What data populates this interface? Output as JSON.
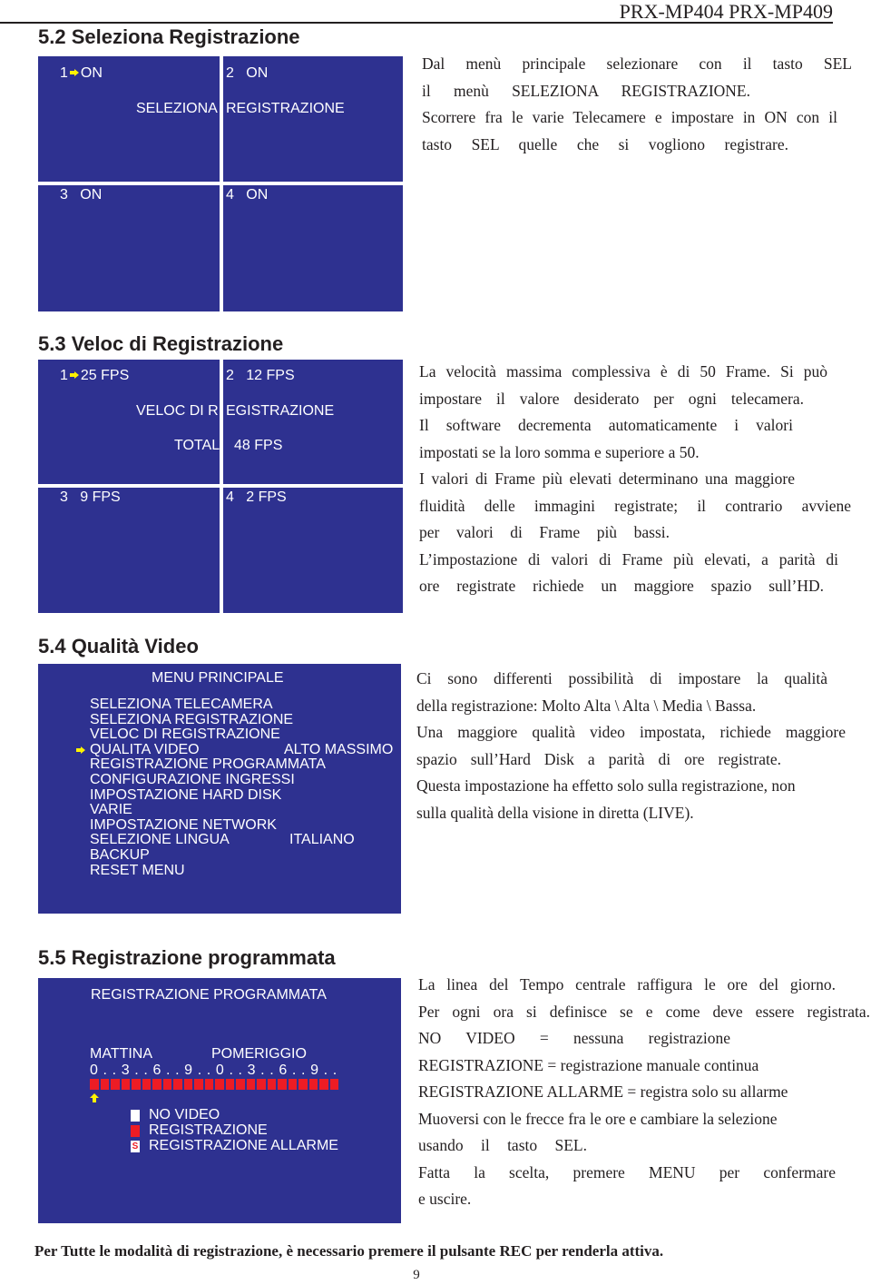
{
  "header": {
    "model": "PRX-MP404  PRX-MP409"
  },
  "colors": {
    "osd_background": "#2e3190",
    "osd_text": "#ffffff",
    "cursor_arrow": "#fff200",
    "recording_block": "#ed1c24"
  },
  "section_5_2": {
    "title": "5.2 Seleziona Registrazione",
    "screen": {
      "title_left": "SELEZIONA",
      "title_right": "REGISTRAZIONE",
      "cameras": [
        {
          "num": "1",
          "value": "ON",
          "selected": true
        },
        {
          "num": "2",
          "value": "ON",
          "selected": false
        },
        {
          "num": "3",
          "value": "ON",
          "selected": false
        },
        {
          "num": "4",
          "value": "ON",
          "selected": false
        }
      ]
    },
    "description": [
      "Dal menù principale selezionare con il tasto SEL",
      "il menù SELEZIONA REGISTRAZIONE.",
      "Scorrere fra le varie Telecamere e impostare in ON con il",
      "tasto SEL quelle che si vogliono registrare."
    ]
  },
  "section_5_3": {
    "title": "5.3 Veloc di Registrazione",
    "screen": {
      "title_left": "VELOC DI R",
      "title_right": "EGISTRAZIONE",
      "total_label": "TOTAL",
      "total_value": "48 FPS",
      "cameras": [
        {
          "num": "1",
          "value": "25 FPS",
          "selected": true
        },
        {
          "num": "2",
          "value": "12 FPS",
          "selected": false
        },
        {
          "num": "3",
          "value": "9 FPS",
          "selected": false
        },
        {
          "num": "4",
          "value": "2 FPS",
          "selected": false
        }
      ]
    },
    "description": [
      "La velocità massima complessiva è di 50 Frame. Si può",
      "impostare il valore desiderato per ogni telecamera.",
      "Il software decrementa automaticamente i valori",
      "impostati se la loro somma e superiore a 50.",
      "I valori di Frame più elevati determinano una maggiore",
      "fluidità delle immagini registrate; il contrario avviene",
      "per valori di Frame più bassi.",
      "L’impostazione di valori di Frame più elevati, a parità di",
      "ore registrate richiede un maggiore spazio sull’HD."
    ]
  },
  "section_5_4": {
    "title": "5.4 Qualità Video",
    "screen": {
      "title": "MENU PRINCIPALE",
      "items": [
        {
          "label": "SELEZIONA TELECAMERA",
          "value": "",
          "selected": false
        },
        {
          "label": "SELEZIONA REGISTRAZIONE",
          "value": "",
          "selected": false
        },
        {
          "label": "VELOC DI REGISTRAZIONE",
          "value": "",
          "selected": false
        },
        {
          "label": "QUALITA VIDEO",
          "value": "ALTO MASSIMO",
          "selected": true
        },
        {
          "label": "REGISTRAZIONE PROGRAMMATA",
          "value": "",
          "selected": false
        },
        {
          "label": "CONFIGURAZIONE INGRESSI",
          "value": "",
          "selected": false
        },
        {
          "label": "IMPOSTAZIONE HARD DISK",
          "value": "",
          "selected": false
        },
        {
          "label": "VARIE",
          "value": "",
          "selected": false
        },
        {
          "label": "IMPOSTAZIONE NETWORK",
          "value": "",
          "selected": false
        },
        {
          "label": "SELEZIONE LINGUA",
          "value": "ITALIANO",
          "selected": false
        },
        {
          "label": "BACKUP",
          "value": "",
          "selected": false
        },
        {
          "label": "RESET MENU",
          "value": "",
          "selected": false
        }
      ]
    },
    "description": [
      "Ci sono differenti possibilità di impostare la qualità",
      "della registrazione: Molto Alta \\ Alta \\ Media \\ Bassa.",
      "Una maggiore qualità video impostata, richiede maggiore",
      "spazio sull’Hard Disk a parità di ore registrate.",
      "Questa impostazione ha effetto solo sulla registrazione, non",
      "sulla qualità della visione in diretta (LIVE)."
    ]
  },
  "section_5_5": {
    "title": "5.5 Registrazione programmata",
    "screen": {
      "title": "REGISTRAZIONE PROGRAMMATA",
      "morning_label": "MATTINA",
      "afternoon_label": "POMERIGGIO",
      "hour_scale": "0 . . 3 . . 6 . . 9 . . 0 . . 3 . . 6 . . 9 . .",
      "hours": [
        "REG",
        "REG",
        "REG",
        "REG",
        "REG",
        "REG",
        "REG",
        "REG",
        "REG",
        "REG",
        "REG",
        "REG",
        "REG",
        "REG",
        "REG",
        "REG",
        "REG",
        "REG",
        "REG",
        "REG",
        "REG",
        "REG",
        "REG",
        "REG"
      ],
      "cursor_hour": 0,
      "legend": [
        {
          "type": "no-video",
          "swatch": "",
          "label": "NO VIDEO"
        },
        {
          "type": "recording",
          "swatch": "",
          "label": "REGISTRAZIONE"
        },
        {
          "type": "alarm",
          "swatch": "S",
          "label": "REGISTRAZIONE ALLARME"
        }
      ]
    },
    "description": [
      "La linea del Tempo centrale raffigura le ore del giorno.",
      "Per ogni ora si definisce se e come deve essere registrata.",
      "NO VIDEO = nessuna registrazione",
      "REGISTRAZIONE = registrazione manuale continua",
      "REGISTRAZIONE ALLARME = registra solo su allarme",
      "Muoversi con le frecce fra le ore e cambiare la selezione",
      "usando il tasto SEL.",
      "Fatta la scelta, premere MENU per confermare",
      "e uscire."
    ]
  },
  "footer": {
    "note": "Per Tutte le modalità di registrazione, è necessario premere il pulsante REC per renderla attiva.",
    "page_number": "9"
  }
}
